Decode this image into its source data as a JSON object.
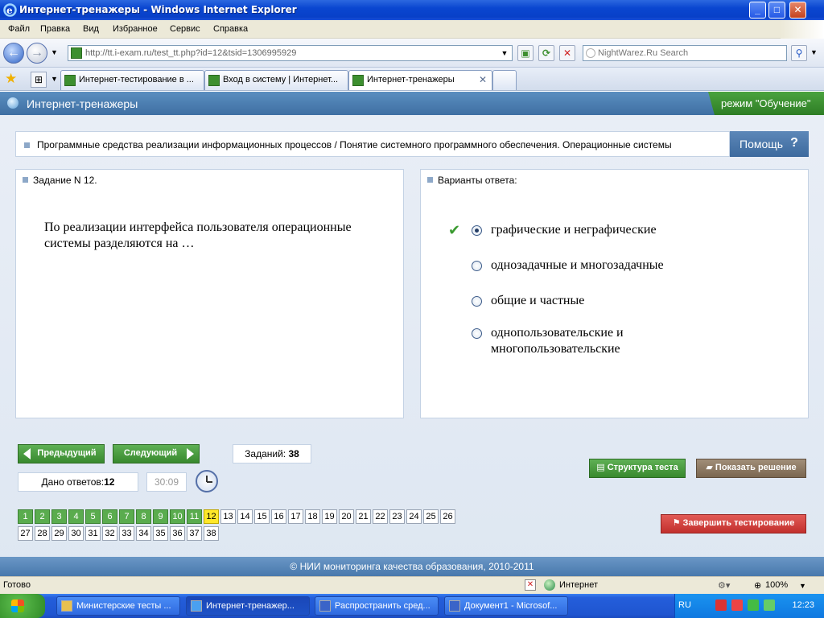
{
  "window": {
    "title": "Интернет-тренажеры - Windows Internet Explorer",
    "minimize": "_",
    "maximize": "□",
    "close": "✕"
  },
  "menu": [
    "Файл",
    "Правка",
    "Вид",
    "Избранное",
    "Сервис",
    "Справка"
  ],
  "address": {
    "url": "http://tt.i-exam.ru/test_tt.php?id=12&tsid=1306995929"
  },
  "search": {
    "placeholder": "NightWarez.Ru Search"
  },
  "tabs": [
    {
      "label": "Интернет-тестирование в ...",
      "active": false
    },
    {
      "label": "Вход в систему | Интернет...",
      "active": false
    },
    {
      "label": "Интернет-тренажеры",
      "active": true
    }
  ],
  "site": {
    "name": "Интернет-тренажеры",
    "mode": "режим \"Обучение\"",
    "breadcrumb": "Программные средства реализации информационных процессов / Понятие системного программного обеспечения. Операционные системы",
    "help": "Помощь",
    "help_symbol": "?"
  },
  "question": {
    "header": "Задание N 12.",
    "text": "По реализации интерфейса пользователя операционные системы разделяются на …"
  },
  "answers": {
    "header": "Варианты ответа:",
    "options": [
      {
        "label": "графические и неграфические",
        "selected": true,
        "correct": true
      },
      {
        "label": "однозадачные и многозадачные",
        "selected": false,
        "correct": false
      },
      {
        "label": "общие и частные",
        "selected": false,
        "correct": false
      },
      {
        "label": "однопользовательские и многопользовательские",
        "selected": false,
        "correct": false
      }
    ]
  },
  "controls": {
    "prev": "Предыдущий",
    "next": "Следующий",
    "tasks_label": "Заданий:",
    "tasks_value": "38",
    "answered_label": "Дано ответов:",
    "answered_value": "12",
    "timer": "30:09",
    "structure": "Структура теста",
    "solution": "Показать решение",
    "finish": "Завершить тестирование"
  },
  "numbers": {
    "total": 38,
    "answered_through": 11,
    "current": 12
  },
  "footer": "© НИИ мониторинга качества образования, 2010-2011",
  "status": {
    "left": "Готово",
    "zone": "Интернет",
    "zoom": "100%"
  },
  "taskbar": {
    "items": [
      {
        "label": "Министерские тесты ...",
        "active": false
      },
      {
        "label": "Интернет-тренажер...",
        "active": true
      },
      {
        "label": "Распространить сред...",
        "active": false
      },
      {
        "label": "Документ1 - Microsof...",
        "active": false
      }
    ],
    "lang": "RU",
    "time": "12:23"
  },
  "colors": {
    "accent_green": "#3d8f2f",
    "site_blue": "#3f6fa3",
    "current_task": "#ffe82a"
  }
}
